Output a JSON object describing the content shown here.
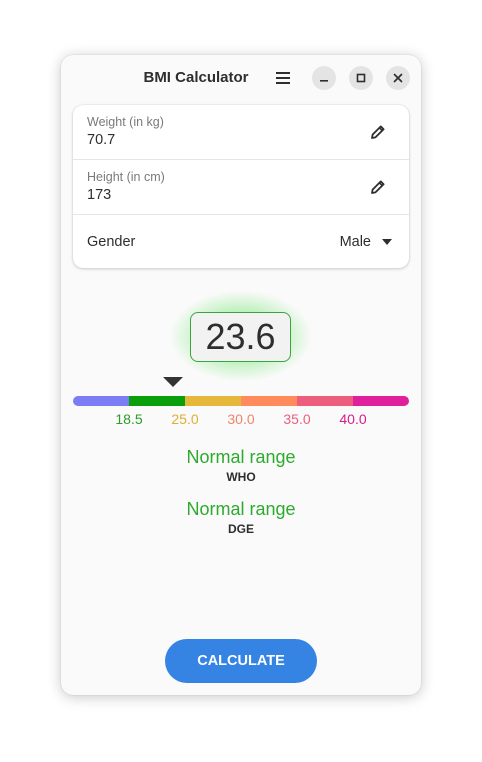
{
  "window": {
    "title": "BMI Calculator"
  },
  "form": {
    "weight": {
      "label": "Weight (in kg)",
      "value": "70.7"
    },
    "height": {
      "label": "Height (in cm)",
      "value": "173"
    },
    "gender": {
      "label": "Gender",
      "value": "Male"
    }
  },
  "result": {
    "bmi": "23.6",
    "bmi_value": 23.6
  },
  "scale": {
    "segment_colors": [
      "#7c7cf4",
      "#0a9e0a",
      "#e5b73b",
      "#ff8a5c",
      "#ec5d7e",
      "#df1f9b"
    ],
    "ticks": [
      {
        "label": "18.5",
        "color": "#2a9d2a"
      },
      {
        "label": "25.0",
        "color": "#e0ae32"
      },
      {
        "label": "30.0",
        "color": "#f0846a"
      },
      {
        "label": "35.0",
        "color": "#ea5f7e"
      },
      {
        "label": "40.0",
        "color": "#d81b8f"
      }
    ]
  },
  "ranges": {
    "who": {
      "text": "Normal range",
      "source": "WHO"
    },
    "dge": {
      "text": "Normal range",
      "source": "DGE"
    }
  },
  "actions": {
    "calculate_label": "CALCULATE"
  },
  "colors": {
    "accent": "#3584e4",
    "normal": "#2eaa2e"
  },
  "icons": {
    "menu": "hamburger-menu-icon",
    "minimize": "minimize-icon",
    "maximize": "maximize-icon",
    "close": "close-icon",
    "edit": "pencil-icon",
    "dropdown": "caret-down-icon"
  }
}
